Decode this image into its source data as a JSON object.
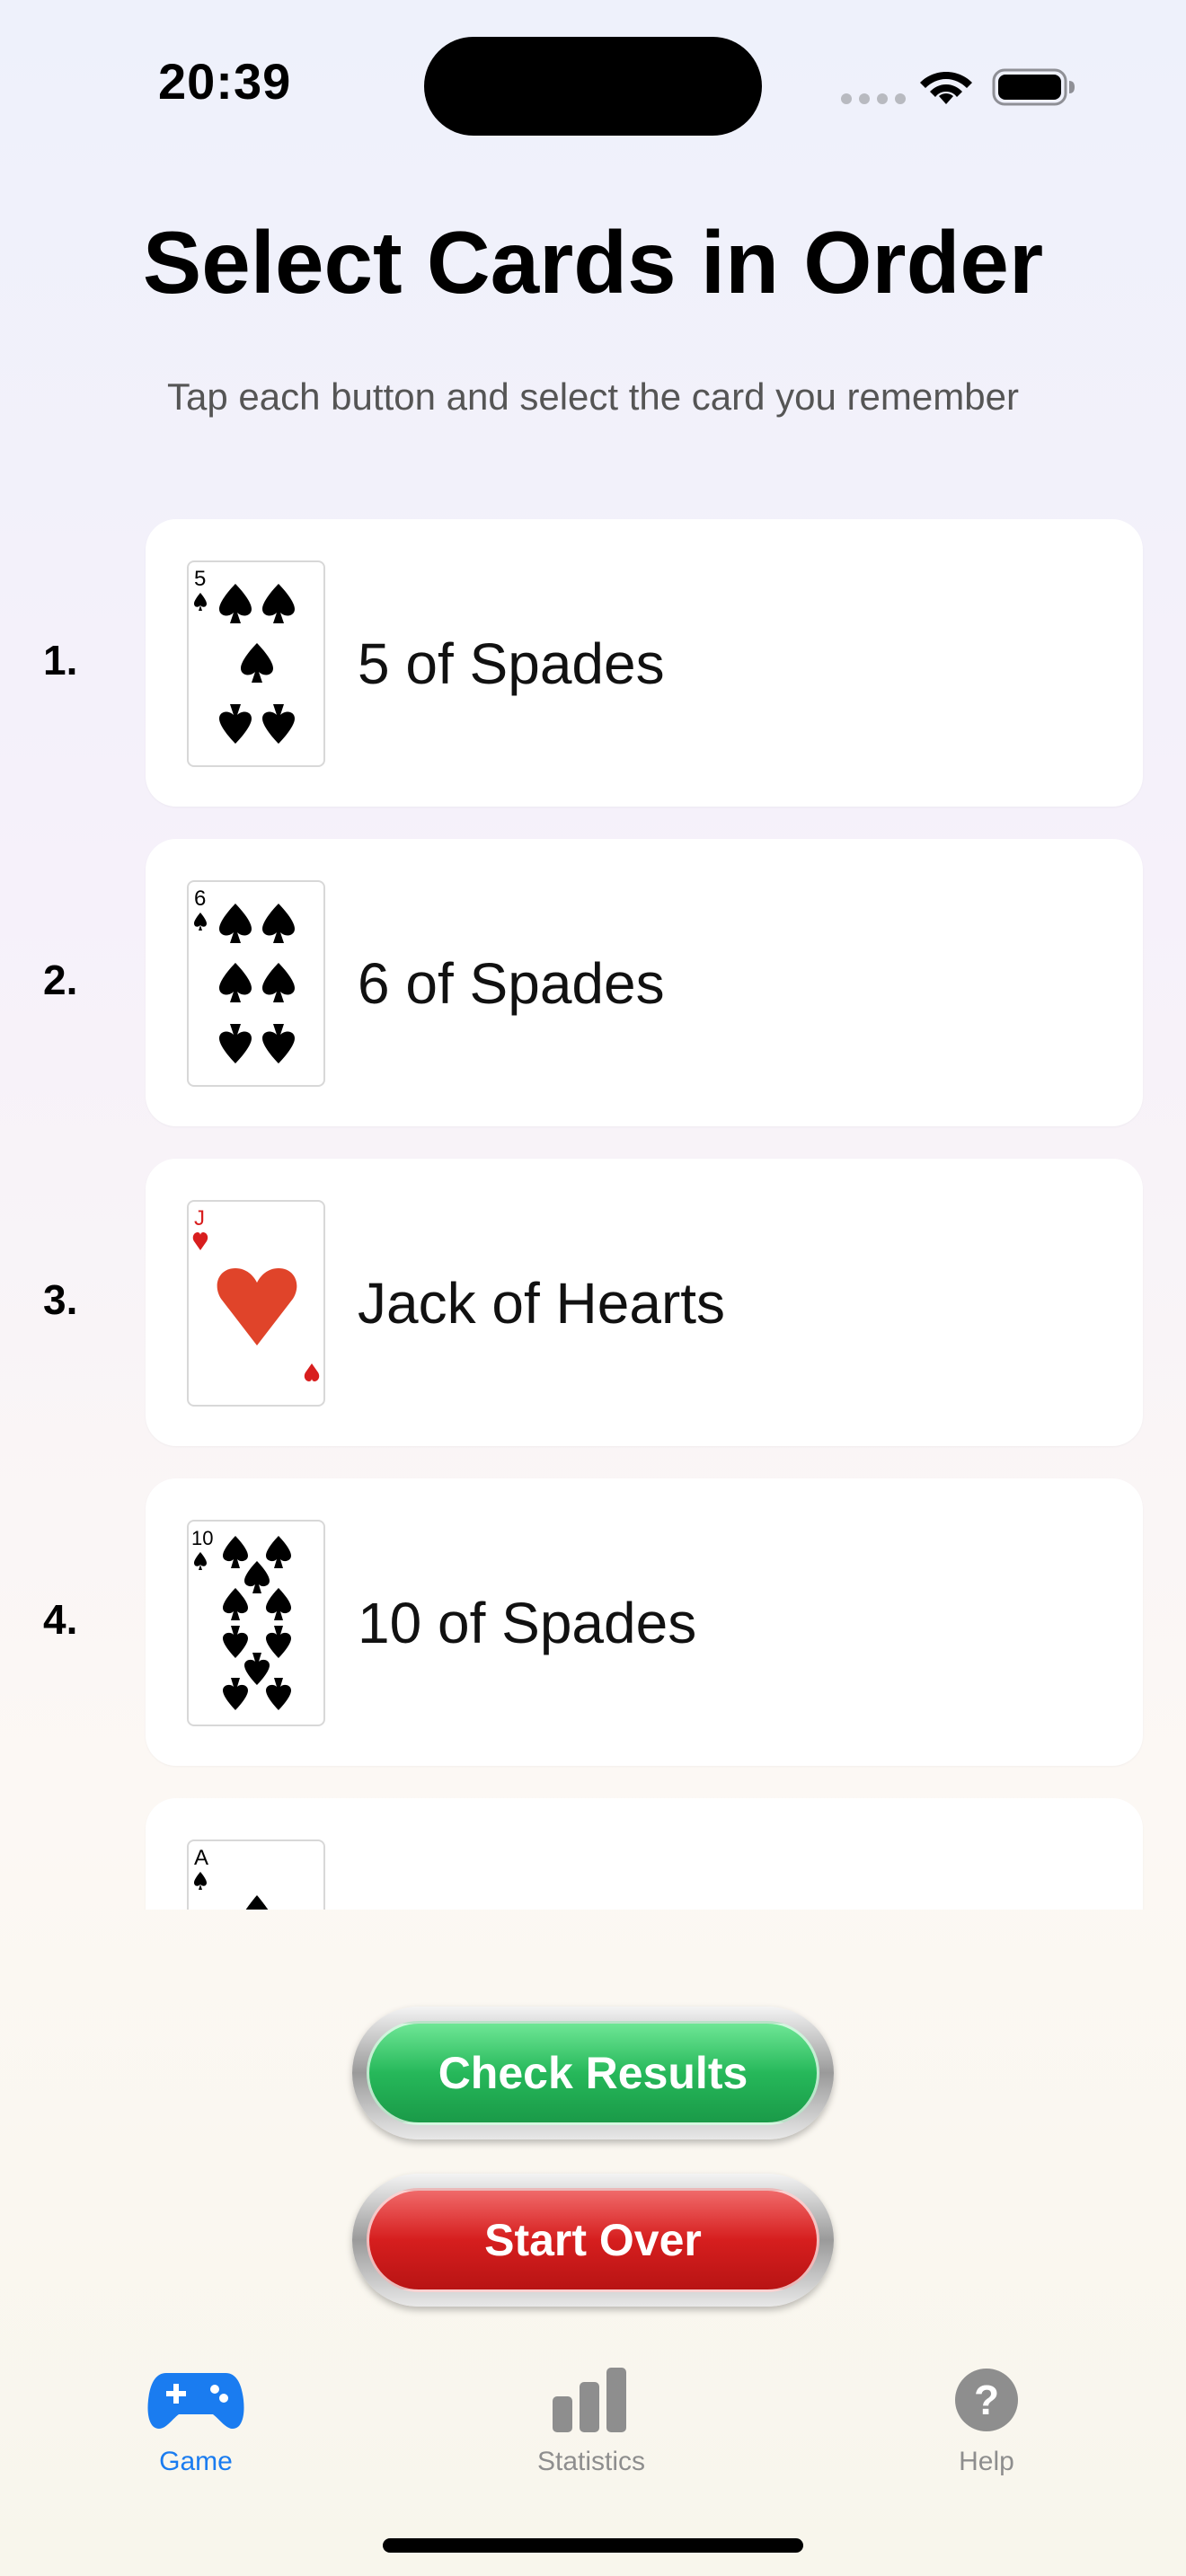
{
  "status_bar": {
    "time": "20:39"
  },
  "header": {
    "title": "Select Cards in Order",
    "subtitle": "Tap each button and select the card you remember"
  },
  "cards": [
    {
      "number": "1.",
      "label": "5 of Spades",
      "rank": "5",
      "suit": "spades",
      "color": "#000000"
    },
    {
      "number": "2.",
      "label": "6 of Spades",
      "rank": "6",
      "suit": "spades",
      "color": "#000000"
    },
    {
      "number": "3.",
      "label": "Jack of Hearts",
      "rank": "J",
      "suit": "hearts",
      "color": "#d81e1e"
    },
    {
      "number": "4.",
      "label": "10 of Spades",
      "rank": "10",
      "suit": "spades",
      "color": "#000000"
    },
    {
      "number": "",
      "label": "",
      "rank": "A",
      "suit": "spades",
      "color": "#000000"
    }
  ],
  "actions": {
    "check_label": "Check Results",
    "start_over_label": "Start Over"
  },
  "tab_bar": {
    "game": "Game",
    "statistics": "Statistics",
    "help": "Help",
    "active_color": "#1a7cf0",
    "inactive_color": "#8e8e8e"
  },
  "icons": {
    "game": "gamecontroller-icon",
    "statistics": "bar-chart-icon",
    "help": "question-circle-icon"
  }
}
